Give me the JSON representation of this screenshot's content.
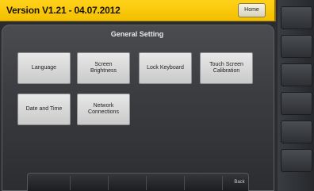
{
  "header": {
    "version": "Version V1.21 - 04.07.2012",
    "home_label": "Home"
  },
  "panel": {
    "title": "General Setting",
    "buttons": [
      "Language",
      "Screen\nBrightness",
      "Lock Keyboard",
      "Touch Screen\nCalibration",
      "Date and Time",
      "Network\nConnections"
    ]
  },
  "footer": {
    "back_label": "Back"
  },
  "colors": {
    "header_yellow": "#f3bf00",
    "panel_dark": "#3b3d41",
    "button_light": "#dcdcdc"
  }
}
